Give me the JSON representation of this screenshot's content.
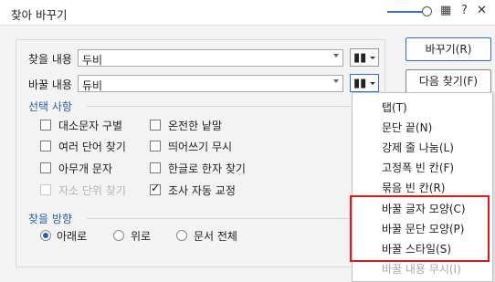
{
  "window": {
    "title": "찾아 바꾸기",
    "icons": [
      "zoom-slider",
      "chat-icon",
      "help-icon",
      "close-icon"
    ],
    "help_glyph": "?",
    "close_glyph": "✕"
  },
  "find": {
    "label": "찾을 내용",
    "value": "두비"
  },
  "replace": {
    "label": "바꿀 내용",
    "value": "듀비"
  },
  "options": {
    "section_title": "선택 사항",
    "items": [
      {
        "label": "대소문자 구별",
        "checked": false,
        "disabled": false
      },
      {
        "label": "온전한 낱말",
        "checked": false,
        "disabled": false
      },
      {
        "label": "여러 단어 찾기",
        "checked": false,
        "disabled": false
      },
      {
        "label": "띄어쓰기 무시",
        "checked": false,
        "disabled": false
      },
      {
        "label": "아무개 문자",
        "checked": false,
        "disabled": false
      },
      {
        "label": "한글로 한자 찾기",
        "checked": false,
        "disabled": false
      },
      {
        "label": "자소 단위 찾기",
        "checked": false,
        "disabled": true
      },
      {
        "label": "조사 자동 교정",
        "checked": true,
        "disabled": false
      }
    ]
  },
  "direction": {
    "section_title": "찾을 방향",
    "options": [
      {
        "label": "아래로",
        "selected": true
      },
      {
        "label": "위로",
        "selected": false
      },
      {
        "label": "문서 전체",
        "selected": false
      }
    ]
  },
  "buttons": {
    "replace": "바꾸기(R)",
    "find_next": "다음 찾기(F)"
  },
  "special_menu": {
    "items": [
      {
        "label": "탭(T)",
        "dim": false
      },
      {
        "label": "문단 끝(N)",
        "dim": false
      },
      {
        "label": "강제 줄 나눔(L)",
        "dim": false
      },
      {
        "label": "고정폭 빈 칸(F)",
        "dim": false
      },
      {
        "label": "묶음 빈 칸(R)",
        "dim": false
      },
      {
        "label": "바꿀 글자 모양(C)",
        "dim": false
      },
      {
        "label": "바꿀 문단 모양(P)",
        "dim": false
      },
      {
        "label": "바꿀 스타일(S)",
        "dim": false
      },
      {
        "label": "바꿀 내용 무시(I)",
        "dim": true
      }
    ]
  },
  "colors": {
    "accent": "#2d5fa8",
    "highlight": "#e3151a"
  }
}
